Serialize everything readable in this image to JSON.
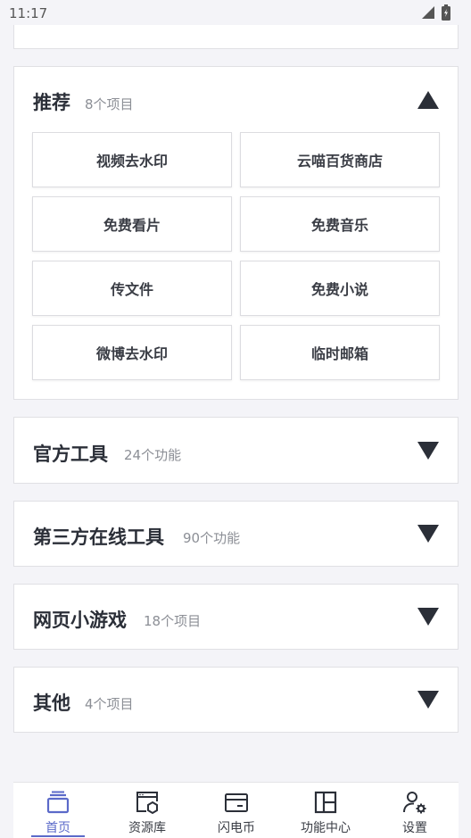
{
  "status_bar": {
    "time": "11:17"
  },
  "sections": [
    {
      "title": "推荐",
      "count": "8个项目",
      "expanded": true,
      "items": [
        "视频去水印",
        "云喵百货商店",
        "免费看片",
        "免费音乐",
        "传文件",
        "免费小说",
        "微博去水印",
        "临时邮箱"
      ]
    },
    {
      "title": "官方工具",
      "count": "24个功能",
      "expanded": false
    },
    {
      "title": "第三方在线工具",
      "count": "90个功能",
      "expanded": false
    },
    {
      "title": "网页小游戏",
      "count": "18个项目",
      "expanded": false
    },
    {
      "title": "其他",
      "count": "4个项目",
      "expanded": false
    }
  ],
  "bottom_nav": {
    "items": [
      {
        "label": "首页",
        "icon": "home-stack-icon",
        "active": true
      },
      {
        "label": "资源库",
        "icon": "resource-library-icon",
        "active": false
      },
      {
        "label": "闪电币",
        "icon": "wallet-card-icon",
        "active": false
      },
      {
        "label": "功能中心",
        "icon": "layout-panel-icon",
        "active": false
      },
      {
        "label": "设置",
        "icon": "user-settings-icon",
        "active": false
      }
    ]
  },
  "colors": {
    "accent": "#5b6ac9",
    "background": "#f4f4f8",
    "card": "#ffffff",
    "text": "#2b2f38",
    "muted": "#8c8f96"
  }
}
